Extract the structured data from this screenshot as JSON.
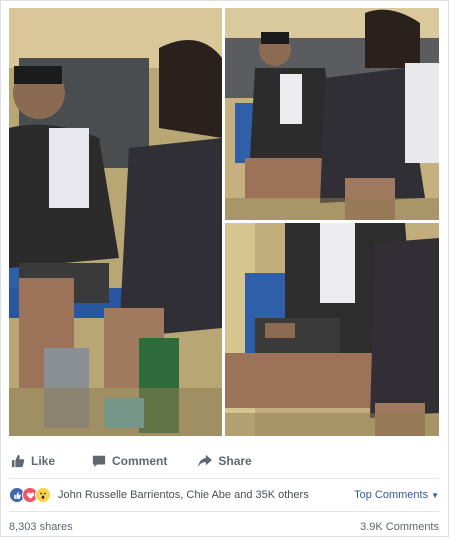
{
  "post": {
    "photos": [
      {
        "name": "photo-left"
      },
      {
        "name": "photo-top-right"
      },
      {
        "name": "photo-bottom-right"
      }
    ]
  },
  "actions": {
    "like_label": "Like",
    "comment_label": "Comment",
    "share_label": "Share"
  },
  "reactions": {
    "icons": [
      "like-reaction-icon",
      "love-reaction-icon",
      "wow-reaction-icon"
    ],
    "summary": "John Russelle Barrientos, Chie Abe and 35K others",
    "top_comments_label": "Top Comments"
  },
  "counts": {
    "shares": "8,303 shares",
    "comments": "3.9K Comments"
  },
  "colors": {
    "link": "#365899",
    "action_text": "#606770",
    "like_blue": "#4267b2",
    "love_red": "#f25268",
    "wow_yellow": "#fcd24d"
  }
}
